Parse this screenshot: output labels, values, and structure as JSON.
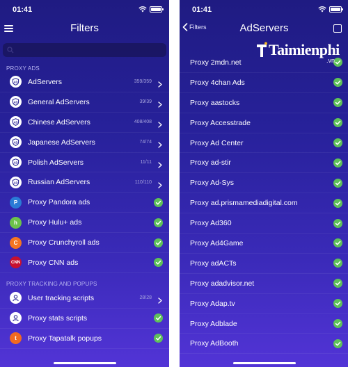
{
  "left_screen": {
    "status": {
      "time": "01:41"
    },
    "nav": {
      "title": "Filters"
    },
    "sections": [
      {
        "header": "PROXY ADS",
        "items": [
          {
            "label": "AdServers",
            "count": "359/359",
            "icon": "ad-shield-icon",
            "accessory": "chevron"
          },
          {
            "label": "General AdServers",
            "count": "39/39",
            "icon": "ad-shield-icon",
            "accessory": "chevron"
          },
          {
            "label": "Chinese AdServers",
            "count": "408/408",
            "icon": "ad-shield-icon",
            "accessory": "chevron"
          },
          {
            "label": "Japanese AdServers",
            "count": "74/74",
            "icon": "ad-shield-icon",
            "accessory": "chevron"
          },
          {
            "label": "Polish AdServers",
            "count": "11/11",
            "icon": "ad-shield-icon",
            "accessory": "chevron"
          },
          {
            "label": "Russian AdServers",
            "count": "110/110",
            "icon": "ad-shield-icon",
            "accessory": "chevron"
          },
          {
            "label": "Proxy Pandora ads",
            "count": "",
            "icon": "pandora-icon",
            "icon_text": "P",
            "accessory": "check"
          },
          {
            "label": "Proxy Hulu+ ads",
            "count": "",
            "icon": "hulu-icon",
            "icon_text": "h",
            "accessory": "check"
          },
          {
            "label": "Proxy Crunchyroll ads",
            "count": "",
            "icon": "crunchyroll-icon",
            "icon_text": "C",
            "accessory": "check"
          },
          {
            "label": "Proxy CNN ads",
            "count": "",
            "icon": "cnn-icon",
            "icon_text": "CNN",
            "accessory": "check"
          }
        ]
      },
      {
        "header": "PROXY TRACKING AND POPUPS",
        "items": [
          {
            "label": "User tracking scripts",
            "count": "28/28",
            "icon": "tracker-icon",
            "accessory": "chevron"
          },
          {
            "label": "Proxy stats scripts",
            "count": "",
            "icon": "tracker-icon",
            "accessory": "check"
          },
          {
            "label": "Proxy Tapatalk popups",
            "count": "",
            "icon": "tapatalk-icon",
            "icon_text": "t",
            "accessory": "check"
          }
        ]
      }
    ]
  },
  "right_screen": {
    "status": {
      "time": "01:41"
    },
    "nav": {
      "back_label": "Filters",
      "title": "AdServers"
    },
    "items": [
      "Proxy 2mdn.net",
      "Proxy 4chan Ads",
      "Proxy aastocks",
      "Proxy Accesstrade",
      "Proxy Ad Center",
      "Proxy ad-stir",
      "Proxy Ad-Sys",
      "Proxy ad.prismamediadigital.com",
      "Proxy Ad360",
      "Proxy Ad4Game",
      "Proxy adACTs",
      "Proxy adadvisor.net",
      "Proxy Adap.tv",
      "Proxy Adblade",
      "Proxy AdBooth"
    ]
  },
  "watermark": {
    "text": "Taimienphi",
    "suffix": ".vn"
  },
  "colors": {
    "background_top": "#1f1b82",
    "background_bottom": "#5234d6",
    "check_green": "#5fc15a",
    "section_header": "#b6b3f0",
    "count_text": "#a8a5de"
  }
}
